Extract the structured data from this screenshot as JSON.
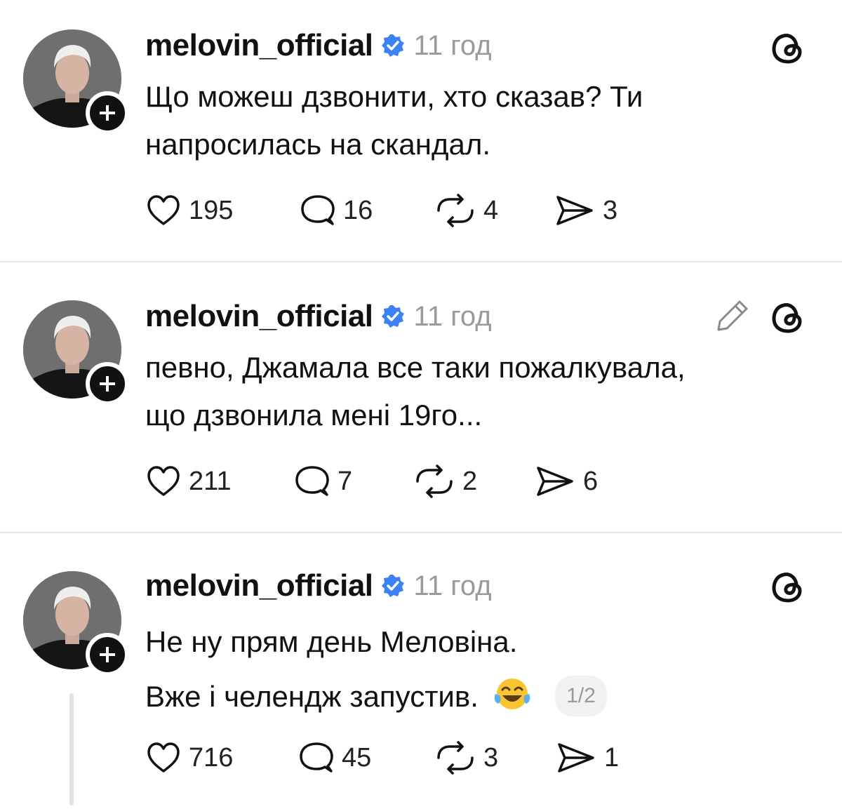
{
  "posts": [
    {
      "username": "melovin_official",
      "time": "11 год",
      "lines": [
        "Що можеш дзвонити, хто сказав? Ти",
        "напросилась на скандал."
      ],
      "likes": "195",
      "replies": "16",
      "reposts": "4",
      "shares": "3",
      "show_edit_icon": false
    },
    {
      "username": "melovin_official",
      "time": "11 год",
      "lines": [
        "певно, Джамала все таки пожалкувала,",
        "що дзвонила мені 19го..."
      ],
      "likes": "211",
      "replies": "7",
      "reposts": "2",
      "shares": "6",
      "show_edit_icon": true
    },
    {
      "username": "melovin_official",
      "time": "11 год",
      "lines": [
        "Не ну прям день Меловіна.",
        "Вже і челендж запустив."
      ],
      "emoji": "face-with-tears-of-joy",
      "page_indicator": "1/2",
      "likes": "716",
      "replies": "45",
      "reposts": "3",
      "shares": "1",
      "show_edit_icon": false
    }
  ],
  "icons": {
    "verified": "verified-badge-icon",
    "like": "heart-icon",
    "reply": "reply-bubble-icon",
    "repost": "repost-icon",
    "share": "send-icon",
    "app": "threads-logo-icon",
    "edit": "pencil-icon",
    "follow": "plus-icon"
  },
  "colors": {
    "verified_blue": "#3b82f6",
    "text": "#111111",
    "muted": "#9a9a9a",
    "divider": "#e6e6e6"
  }
}
